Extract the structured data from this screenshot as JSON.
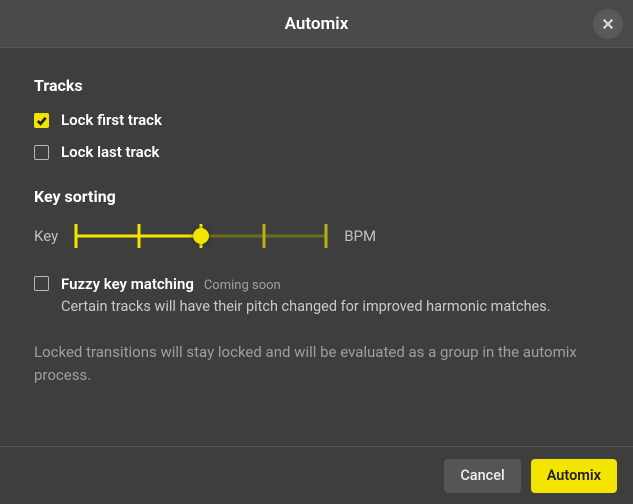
{
  "dialog": {
    "title": "Automix"
  },
  "tracks": {
    "heading": "Tracks",
    "lock_first": {
      "label": "Lock first track",
      "checked": true
    },
    "lock_last": {
      "label": "Lock last track",
      "checked": false
    }
  },
  "key_sorting": {
    "heading": "Key sorting",
    "left_label": "Key",
    "right_label": "BPM",
    "slider": {
      "value": 2,
      "max": 4
    },
    "fuzzy": {
      "label": "Fuzzy key matching",
      "badge": "Coming soon",
      "description": "Certain tracks will have their pitch changed for improved harmonic matches.",
      "checked": false
    }
  },
  "note": "Locked transitions will stay locked and will be evaluated as a group in the automix process.",
  "footer": {
    "cancel": "Cancel",
    "confirm": "Automix"
  }
}
